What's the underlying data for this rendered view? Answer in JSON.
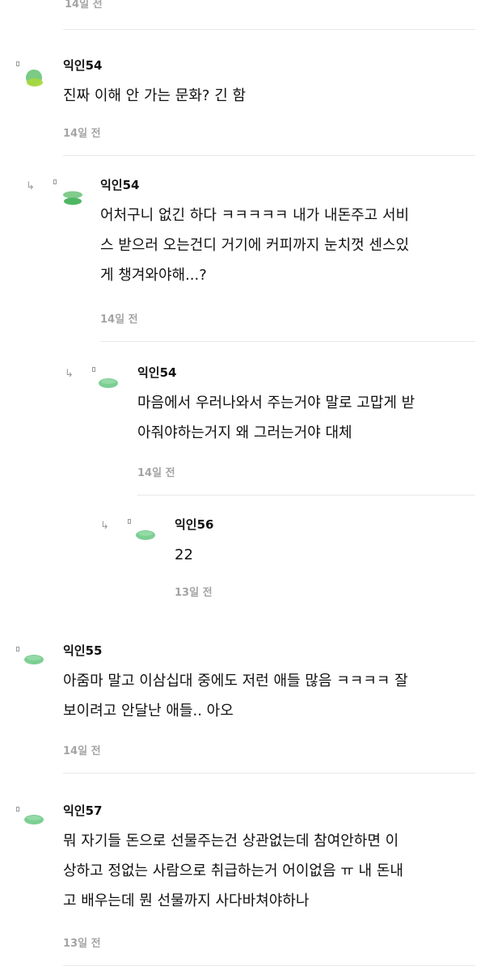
{
  "header": {
    "previous_time": "14일 전"
  },
  "comments": [
    {
      "name": "익인54",
      "body": "진짜 이해 안 가는 문화? 긴 함",
      "time": "14일 전"
    },
    {
      "name": "익인54",
      "body": "어처구니 없긴 하다 ㅋㅋㅋㅋㅋ 내가 내돈주고 서비\n스 받으러 오는건디 거기에 커피까지 눈치껏 센스있\n게 챙겨와야해...?",
      "time": "14일 전"
    },
    {
      "name": "익인54",
      "body": "마음에서 우러나와서 주는거야 말로 고맙게 받\n아줘야하는거지 왜 그러는거야 대체",
      "time": "14일 전"
    },
    {
      "name": "익인56",
      "body": "22",
      "time": "13일 전"
    },
    {
      "name": "익인55",
      "body": "아줌마 말고 이삼십대 중에도 저런 애들 많음 ㅋㅋㅋㅋ 잘\n보이려고 안달난 애들.. 아오",
      "time": "14일 전"
    },
    {
      "name": "익인57",
      "body": "뭐 자기들 돈으로 선물주는건 상관없는데 참여안하면 이\n상하고 정없는 사람으로 취급하는거 어이없음 ㅠ 내 돈내\n고 배우는데 뭔 선물까지 사다바쳐야하나",
      "time": "13일 전"
    }
  ],
  "icons": {
    "reply": "reply-arrow-icon",
    "avatar": "green-blob-avatar-icon"
  },
  "colors": {
    "avatar_green": "#79c990",
    "avatar_lime": "#98d353",
    "time_gray": "#a4a4a4",
    "divider": "#e9e9e9"
  }
}
